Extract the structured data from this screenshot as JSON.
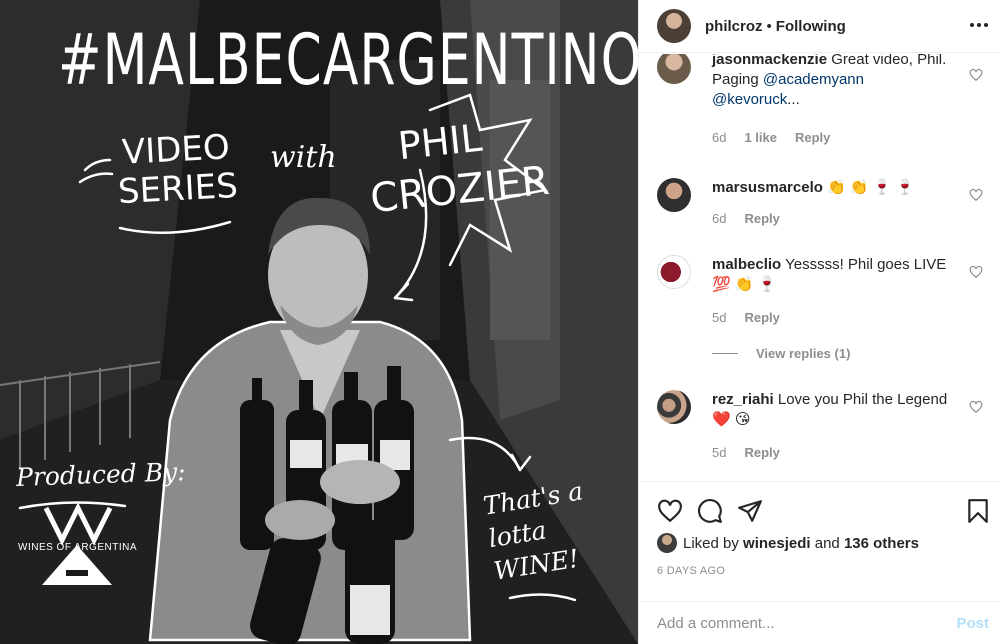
{
  "image": {
    "hashtag": "#MALBECARGENTINO",
    "video_line": "VIDEO",
    "series_line": "SERIES",
    "with": "with",
    "phil": "PHIL",
    "crozier": "CROZIER",
    "produced_by": "Produced By:",
    "wines_of_argentina": "WINES OF ARGENTINA",
    "lotta_wine": "That's a lotta WINE!"
  },
  "header": {
    "username": "philcroz",
    "separator": "•",
    "follow_status": "Following"
  },
  "comments": [
    {
      "username": "jasonmackenzie",
      "text": "Great video, Phil. Paging ",
      "mentions": [
        "@academyann",
        "@kevoruck"
      ],
      "trailing": "...",
      "time": "6d",
      "likes": "1 like",
      "reply": "Reply"
    },
    {
      "username": "marsusmarcelo",
      "text": "👏 👏 🍷 🍷",
      "time": "6d",
      "reply": "Reply"
    },
    {
      "username": "malbeclio",
      "text": "Yesssss! Phil goes LIVE",
      "text2": "💯 👏 🍷",
      "time": "5d",
      "reply": "Reply"
    },
    {
      "username": "rez_riahi",
      "text": "Love you Phil the Legend",
      "text2": "❤️ 😘",
      "time": "5d",
      "reply": "Reply"
    }
  ],
  "view_replies": "View replies (1)",
  "likes": {
    "prefix": "Liked by ",
    "user": "winesjedi",
    "middle": " and ",
    "others": "136 others"
  },
  "timestamp": "6 DAYS AGO",
  "add_comment": {
    "placeholder": "Add a comment...",
    "post_label": "Post"
  },
  "colors": {
    "text": "#262626",
    "muted": "#8e8e8e",
    "mention": "#00376b",
    "post_disabled": "#b2dffc",
    "border": "#efefef"
  }
}
